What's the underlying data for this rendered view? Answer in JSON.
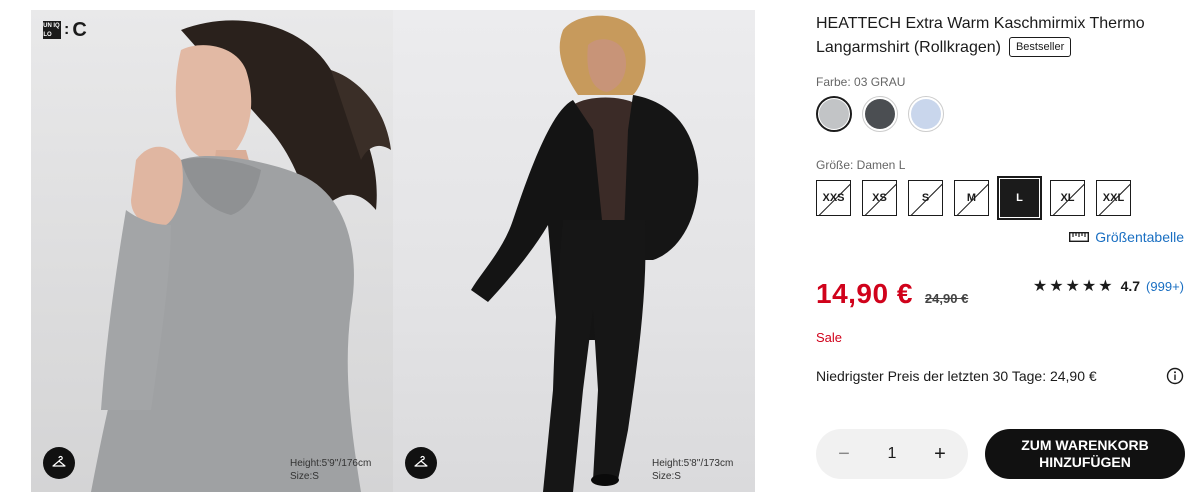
{
  "brand": {
    "logo_text": "UNIQLO",
    "logo_mark": "C",
    "logo_colon": ":"
  },
  "gallery": {
    "images": [
      {
        "model_height": "Height:5'9''/176cm",
        "model_size": "Size:S",
        "icon": "hanger-icon"
      },
      {
        "model_height": "Height:5'8''/173cm",
        "model_size": "Size:S",
        "icon": "hanger-icon"
      }
    ]
  },
  "product": {
    "title": "HEATTECH Extra Warm Kaschmirmix Thermo Langarmshirt (Rollkragen)",
    "badge": "Bestseller",
    "color_label": "Farbe: 03 GRAU",
    "colors": [
      {
        "name": "grau",
        "hex": "#c2c4c6",
        "selected": true
      },
      {
        "name": "dunkelgrau",
        "hex": "#4b4e52",
        "selected": false
      },
      {
        "name": "hellblau",
        "hex": "#c9d6ec",
        "selected": false
      }
    ],
    "size_label": "Größe: Damen L",
    "sizes": [
      {
        "label": "XXS",
        "available": false,
        "selected": false
      },
      {
        "label": "XS",
        "available": false,
        "selected": false
      },
      {
        "label": "S",
        "available": false,
        "selected": false
      },
      {
        "label": "M",
        "available": false,
        "selected": false
      },
      {
        "label": "L",
        "available": true,
        "selected": true
      },
      {
        "label": "XL",
        "available": false,
        "selected": false
      },
      {
        "label": "XXL",
        "available": false,
        "selected": false
      }
    ],
    "size_chart_link": "Größentabelle",
    "price": "14,90 €",
    "old_price": "24,90 €",
    "rating": {
      "stars": "★★★★★",
      "value": "4.7",
      "count": "(999+)"
    },
    "sale_label": "Sale",
    "lowest_price_note": "Niedrigster Preis der letzten 30 Tage: 24,90 €",
    "quantity": "1",
    "qty_minus": "−",
    "qty_plus": "+",
    "add_to_cart": "ZUM WARENKORB HINZUFÜGEN"
  },
  "colors": {
    "sale_red": "#d0021b",
    "link_blue": "#1a6fc2",
    "ink": "#1b1b1b"
  }
}
